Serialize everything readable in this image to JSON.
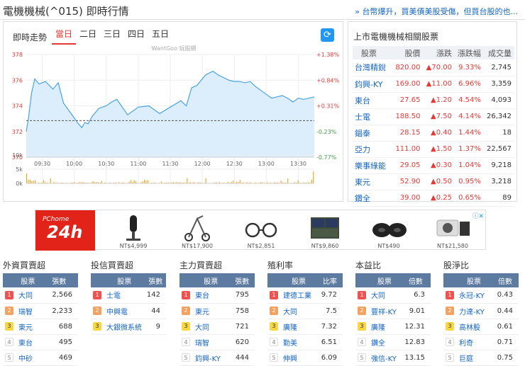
{
  "header": {
    "title": "電機機械(^015) 即時行情",
    "news": "» 台幣爆升，買美債美股受傷，但買台股的也..."
  },
  "chart": {
    "label": "即時走勢",
    "tabs": [
      "當日",
      "二日",
      "三日",
      "四日",
      "五日"
    ],
    "watermark": "WantGoo 玩股網",
    "refresh_icon": "refresh-icon",
    "colors": {
      "line": "#4aa3df",
      "fill": "#dceefb",
      "up": "#e53935",
      "down": "#43a047",
      "volume": "#f5a623"
    }
  },
  "chart_data": {
    "type": "area",
    "y_ticks_left": [
      "378",
      "376",
      "374",
      "372",
      "370"
    ],
    "y_ticks_right": [
      "+1.38%",
      "+0.84%",
      "+0.31%",
      "-0.23%",
      "-0.77%"
    ],
    "ylim": [
      370,
      378
    ],
    "reference_close": 372.85,
    "x_ticks": [
      "09:30",
      "10:00",
      "10:30",
      "11:00",
      "11:30",
      "12:00",
      "12:30",
      "13:00",
      "13:30"
    ],
    "price": {
      "t": [
        0,
        2,
        5,
        8,
        12,
        18,
        25,
        30,
        35,
        42,
        48,
        52,
        55,
        58,
        62,
        68,
        75,
        80,
        85,
        95,
        105,
        115,
        125,
        135,
        145,
        150,
        155,
        160,
        168,
        175,
        180,
        185,
        190,
        195,
        200,
        205,
        210,
        215,
        220,
        225,
        230,
        235,
        240,
        245,
        250,
        255,
        260,
        265,
        270
      ],
      "v": [
        372.0,
        373.0,
        375.0,
        376.1,
        375.7,
        375.9,
        375.3,
        375.8,
        374.2,
        373.4,
        372.7,
        372.3,
        372.7,
        372.6,
        373.2,
        373.8,
        374.0,
        374.3,
        374.5,
        373.3,
        373.9,
        374.0,
        373.4,
        373.9,
        374.4,
        374.0,
        375.4,
        375.6,
        376.4,
        376.7,
        376.4,
        376.2,
        376.0,
        375.9,
        375.9,
        375.8,
        375.9,
        375.5,
        375.2,
        374.9,
        374.6,
        374.7,
        374.8,
        374.6,
        374.3,
        374.6,
        374.5,
        374.6,
        374.7
      ]
    },
    "volume_ticks": [
      "10k",
      "5k",
      "0k"
    ],
    "volume_max": 10000,
    "volume_last": 4200
  },
  "related": {
    "title": "上市電機機械相關股票",
    "headers": [
      "股票",
      "股價",
      "漲跌",
      "漲跌幅",
      "成交量"
    ],
    "rows": [
      {
        "name": "台灣精銳",
        "price": "820.00",
        "change": "▲70.00",
        "pct": "9.33%",
        "vol": "2,745"
      },
      {
        "name": "鈞興-KY",
        "price": "169.00",
        "change": "▲11.00",
        "pct": "6.96%",
        "vol": "3,359"
      },
      {
        "name": "東台",
        "price": "27.65",
        "change": "▲1.20",
        "pct": "4.54%",
        "vol": "4,093"
      },
      {
        "name": "士電",
        "price": "188.50",
        "change": "▲7.50",
        "pct": "4.14%",
        "vol": "26,342"
      },
      {
        "name": "錩泰",
        "price": "28.15",
        "change": "▲0.40",
        "pct": "1.44%",
        "vol": "18"
      },
      {
        "name": "亞力",
        "price": "111.00",
        "change": "▲1.50",
        "pct": "1.37%",
        "vol": "22,567"
      },
      {
        "name": "樂事綠能",
        "price": "29.05",
        "change": "▲0.30",
        "pct": "1.04%",
        "vol": "9,218"
      },
      {
        "name": "東元",
        "price": "52.90",
        "change": "▲0.50",
        "pct": "0.95%",
        "vol": "3,218"
      },
      {
        "name": "鑽全",
        "price": "39.00",
        "change": "▲0.25",
        "pct": "0.65%",
        "vol": "89"
      }
    ]
  },
  "ad": {
    "brand_small": "PChome",
    "brand_big": "24h",
    "close_icon": "close-icon",
    "items": [
      {
        "price": "NT$4,999"
      },
      {
        "price": "NT$17,900"
      },
      {
        "price": "NT$2,851"
      },
      {
        "price": "NT$9,860"
      },
      {
        "price": "NT$490"
      },
      {
        "price": "NT$21,580"
      }
    ]
  },
  "rankings": [
    {
      "title": "外資買賣超",
      "col_stock": "股票",
      "col_value": "張數",
      "rows": [
        [
          "大同",
          "2,566"
        ],
        [
          "瑞智",
          "2,233"
        ],
        [
          "東元",
          "688"
        ],
        [
          "東台",
          "495"
        ],
        [
          "中砂",
          "469"
        ]
      ]
    },
    {
      "title": "投信買賣超",
      "col_stock": "股票",
      "col_value": "張數",
      "rows": [
        [
          "士電",
          "142"
        ],
        [
          "中興電",
          "44"
        ],
        [
          "大銀微系統",
          "9"
        ]
      ]
    },
    {
      "title": "主力買賣超",
      "col_stock": "股票",
      "col_value": "張數",
      "rows": [
        [
          "東台",
          "795"
        ],
        [
          "東元",
          "758"
        ],
        [
          "大同",
          "721"
        ],
        [
          "瑞智",
          "620"
        ],
        [
          "鈞興-KY",
          "444"
        ]
      ]
    },
    {
      "title": "殖利率",
      "col_stock": "股票",
      "col_value": "比率",
      "rows": [
        [
          "建德工業",
          "9.72"
        ],
        [
          "大同",
          "7.5"
        ],
        [
          "廣隆",
          "7.32"
        ],
        [
          "勤美",
          "6.51"
        ],
        [
          "伸興",
          "6.09"
        ]
      ]
    },
    {
      "title": "本益比",
      "col_stock": "股票",
      "col_value": "倍數",
      "rows": [
        [
          "大同",
          "6.3"
        ],
        [
          "豐祥-KY",
          "9.01"
        ],
        [
          "廣隆",
          "12.31"
        ],
        [
          "鑽全",
          "12.83"
        ],
        [
          "強信-KY",
          "13.15"
        ]
      ]
    },
    {
      "title": "股淨比",
      "col_stock": "股票",
      "col_value": "倍數",
      "rows": [
        [
          "永冠-KY",
          "0.43"
        ],
        [
          "力達-KY",
          "0.44"
        ],
        [
          "高林股",
          "0.61"
        ],
        [
          "利奇",
          "0.71"
        ],
        [
          "巨庭",
          "0.75"
        ]
      ]
    }
  ]
}
